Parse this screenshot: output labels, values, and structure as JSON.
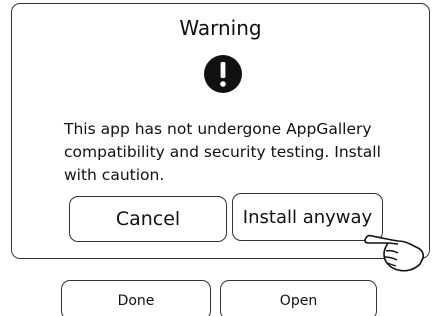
{
  "dialog": {
    "title": "Warning",
    "icon": "exclamation-icon",
    "message": "This app has not undergone AppGallery compatibility and security testing. Install with caution.",
    "cancel_label": "Cancel",
    "install_label": "Install anyway"
  },
  "footer": {
    "done_label": "Done",
    "open_label": "Open"
  },
  "pointer": {
    "icon": "pointing-hand-icon"
  }
}
